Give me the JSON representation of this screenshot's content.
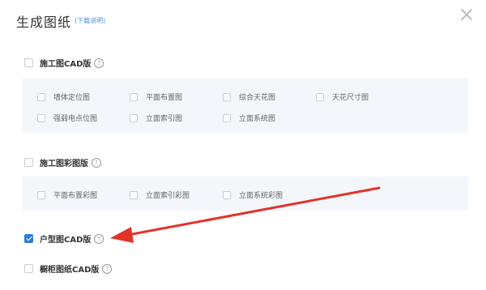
{
  "dialog": {
    "title": "生成图纸",
    "download_link": "(下载说明)",
    "close_icon": "close-icon"
  },
  "sections": [
    {
      "label": "施工图CAD版",
      "checked": false,
      "options": [
        {
          "label": "墙体定位图",
          "checked": false
        },
        {
          "label": "平面布置图",
          "checked": false
        },
        {
          "label": "综合天花图",
          "checked": false
        },
        {
          "label": "天花尺寸图",
          "checked": false
        },
        {
          "label": "强弱电点位图",
          "checked": false
        },
        {
          "label": "立面索引图",
          "checked": false
        },
        {
          "label": "立面系统图",
          "checked": false
        }
      ]
    },
    {
      "label": "施工图彩图版",
      "checked": false,
      "options": [
        {
          "label": "平面布置彩图",
          "checked": false
        },
        {
          "label": "立面索引彩图",
          "checked": false
        },
        {
          "label": "立面系统彩图",
          "checked": false
        }
      ]
    },
    {
      "label": "户型图CAD版",
      "checked": true,
      "options": []
    },
    {
      "label": "橱柜图纸CAD版",
      "checked": false,
      "options": []
    }
  ],
  "help_icon_glyph": "?",
  "annotation": {
    "arrow_color": "#e0332b"
  },
  "colors": {
    "accent": "#2f7ce0",
    "panel_bg": "#f3f6fa",
    "link": "#4a90e2"
  }
}
